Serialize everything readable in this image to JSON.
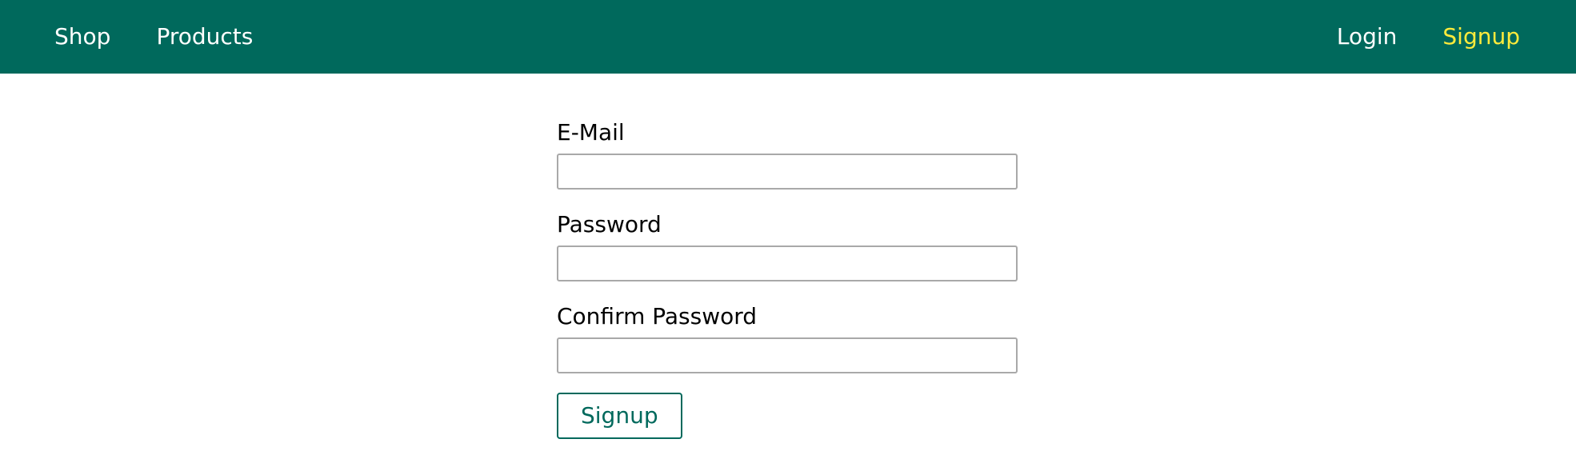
{
  "header": {
    "nav_left": [
      {
        "label": "Shop"
      },
      {
        "label": "Products"
      }
    ],
    "nav_right": [
      {
        "label": "Login",
        "active": false
      },
      {
        "label": "Signup",
        "active": true
      }
    ],
    "colors": {
      "bar": "#00695c",
      "link": "#ffffff",
      "active_link": "#ffeb3b"
    }
  },
  "form": {
    "email": {
      "label": "E-Mail",
      "value": "",
      "placeholder": ""
    },
    "password": {
      "label": "Password",
      "value": "",
      "placeholder": ""
    },
    "confirm_password": {
      "label": "Confirm Password",
      "value": "",
      "placeholder": ""
    },
    "submit_label": "Signup"
  }
}
